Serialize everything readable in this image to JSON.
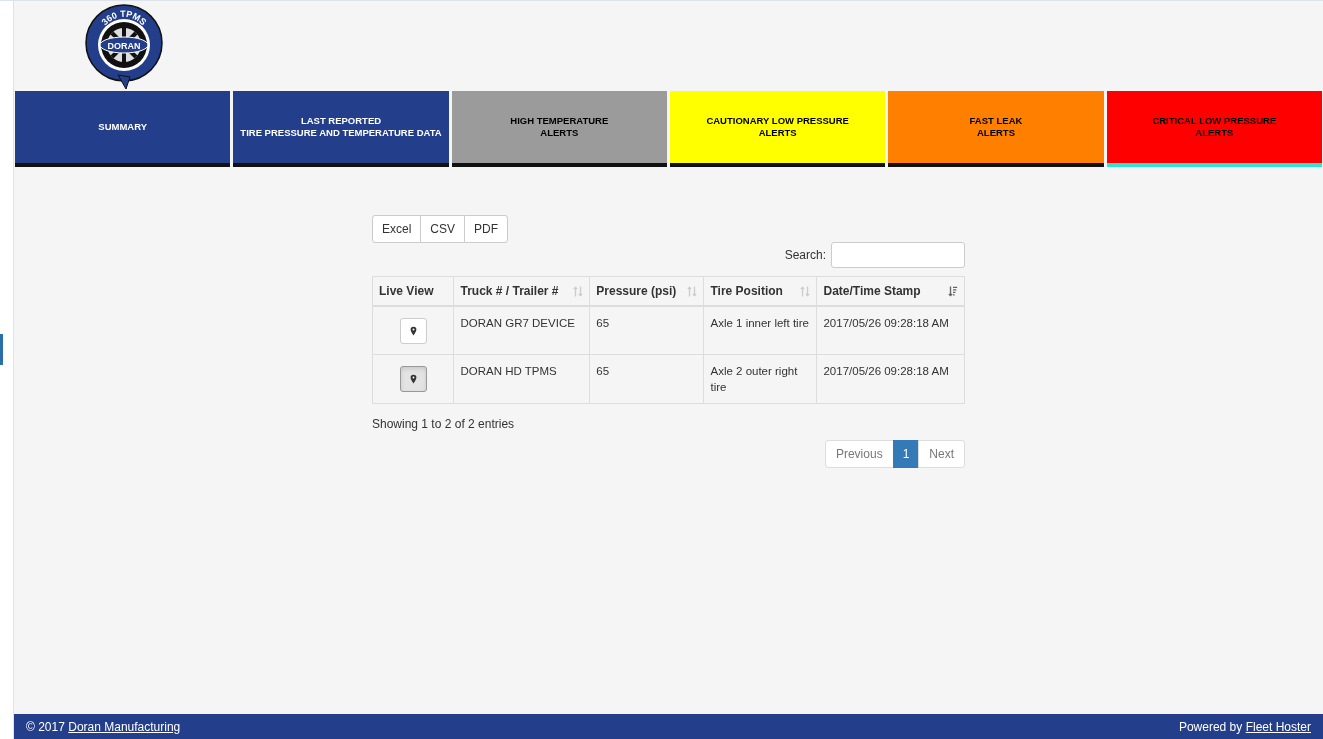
{
  "logo": {
    "ring_text": "360 TPMS",
    "badge_text": "DORAN"
  },
  "tabs": [
    {
      "lines": [
        "SUMMARY"
      ],
      "color": "#233e8b",
      "selected": false
    },
    {
      "lines": [
        "LAST REPORTED",
        "TIRE PRESSURE AND TEMPERATURE DATA"
      ],
      "color": "#233e8b",
      "selected": false
    },
    {
      "lines": [
        "HIGH TEMPERATURE",
        "ALERTS"
      ],
      "color": "#9b9b9b",
      "selected": false
    },
    {
      "lines": [
        "CAUTIONARY LOW PRESSURE",
        "ALERTS"
      ],
      "color": "#ffff00",
      "selected": false
    },
    {
      "lines": [
        "FAST LEAK",
        "ALERTS"
      ],
      "color": "#ff8000",
      "selected": false
    },
    {
      "lines": [
        "CRITICAL LOW PRESSURE",
        "ALERTS"
      ],
      "color": "#ff0000",
      "selected": true
    }
  ],
  "export_buttons": [
    "Excel",
    "CSV",
    "PDF"
  ],
  "search": {
    "label": "Search:"
  },
  "table": {
    "columns": [
      {
        "label": "Live View",
        "kind": "plain"
      },
      {
        "label": "Truck # / Trailer #",
        "kind": "sortable"
      },
      {
        "label": "Pressure (psi)",
        "kind": "sortable"
      },
      {
        "label": "Tire Position",
        "kind": "sortable"
      },
      {
        "label": "Date/Time Stamp",
        "kind": "descending"
      }
    ],
    "rows": [
      {
        "live_view_active": false,
        "cells": [
          "",
          "DORAN GR7 DEVICE",
          "65",
          "Axle 1 inner left tire",
          "2017/05/26 09:28:18 AM"
        ]
      },
      {
        "live_view_active": true,
        "cells": [
          "",
          "DORAN HD TPMS",
          "65",
          "Axle 2 outer right tire",
          "2017/05/26 09:28:18 AM"
        ]
      }
    ]
  },
  "info": "Showing 1 to 2 of 2 entries",
  "pagination": [
    {
      "label": "Previous",
      "selected": false,
      "disabled": true
    },
    {
      "label": "1",
      "selected": true,
      "disabled": false
    },
    {
      "label": "Next",
      "selected": false,
      "disabled": true
    }
  ],
  "footer": {
    "copyright": "© 2017",
    "company_link": "Doran Manufacturing",
    "powered": "Powered by",
    "powered_link": "Fleet Hoster"
  }
}
